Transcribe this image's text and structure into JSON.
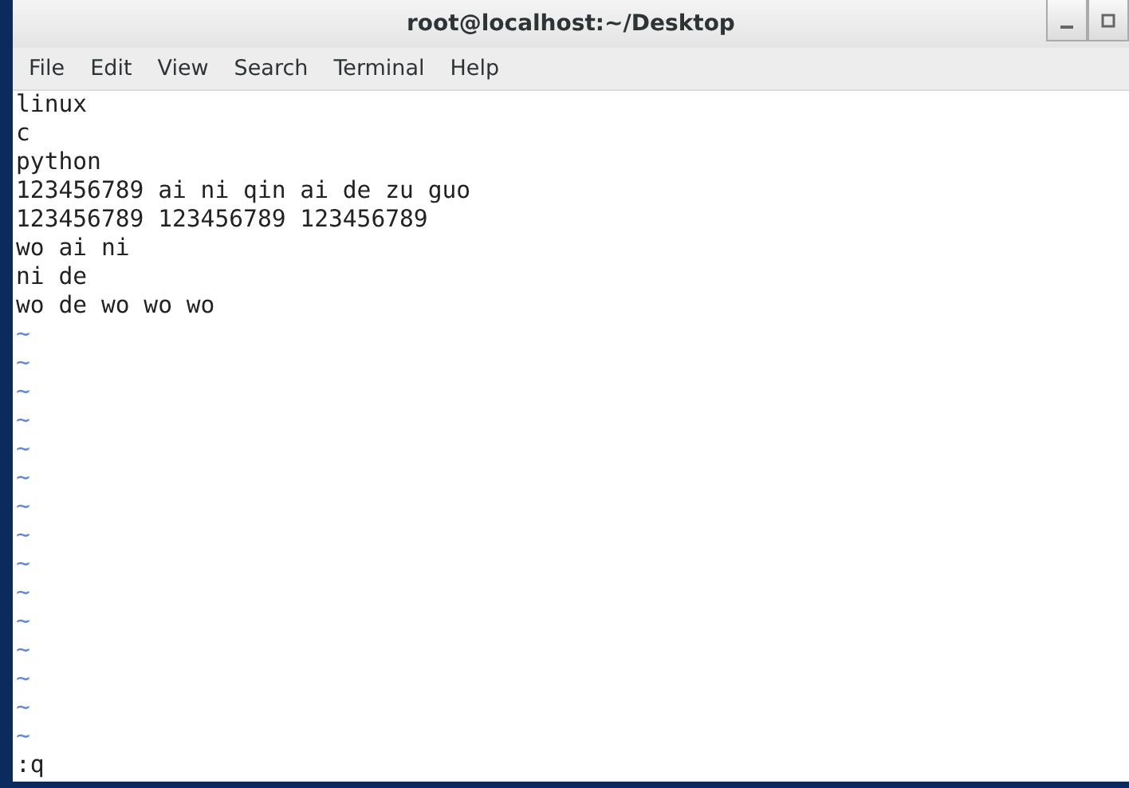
{
  "window": {
    "title": "root@localhost:~/Desktop"
  },
  "menu": [
    "File",
    "Edit",
    "View",
    "Search",
    "Terminal",
    "Help"
  ],
  "lines": [
    {
      "kind": "text",
      "text": "linux"
    },
    {
      "kind": "text",
      "text": "c"
    },
    {
      "kind": "text",
      "text": "python"
    },
    {
      "kind": "text",
      "text": "123456789 ai ni qin ai de zu guo"
    },
    {
      "kind": "text",
      "text": "123456789 123456789 123456789"
    },
    {
      "kind": "text",
      "text": "wo ai ni"
    },
    {
      "kind": "text",
      "text": "ni de"
    },
    {
      "kind": "text",
      "text": "wo de wo wo wo"
    },
    {
      "kind": "tilde",
      "text": "~"
    },
    {
      "kind": "tilde",
      "text": "~"
    },
    {
      "kind": "tilde",
      "text": "~"
    },
    {
      "kind": "tilde",
      "text": "~"
    },
    {
      "kind": "tilde",
      "text": "~"
    },
    {
      "kind": "tilde",
      "text": "~"
    },
    {
      "kind": "tilde",
      "text": "~"
    },
    {
      "kind": "tilde",
      "text": "~"
    },
    {
      "kind": "tilde",
      "text": "~"
    },
    {
      "kind": "tilde",
      "text": "~"
    },
    {
      "kind": "tilde",
      "text": "~"
    },
    {
      "kind": "tilde",
      "text": "~"
    },
    {
      "kind": "tilde",
      "text": "~"
    },
    {
      "kind": "tilde",
      "text": "~"
    },
    {
      "kind": "tilde",
      "text": "~"
    }
  ],
  "command_line": ":q"
}
